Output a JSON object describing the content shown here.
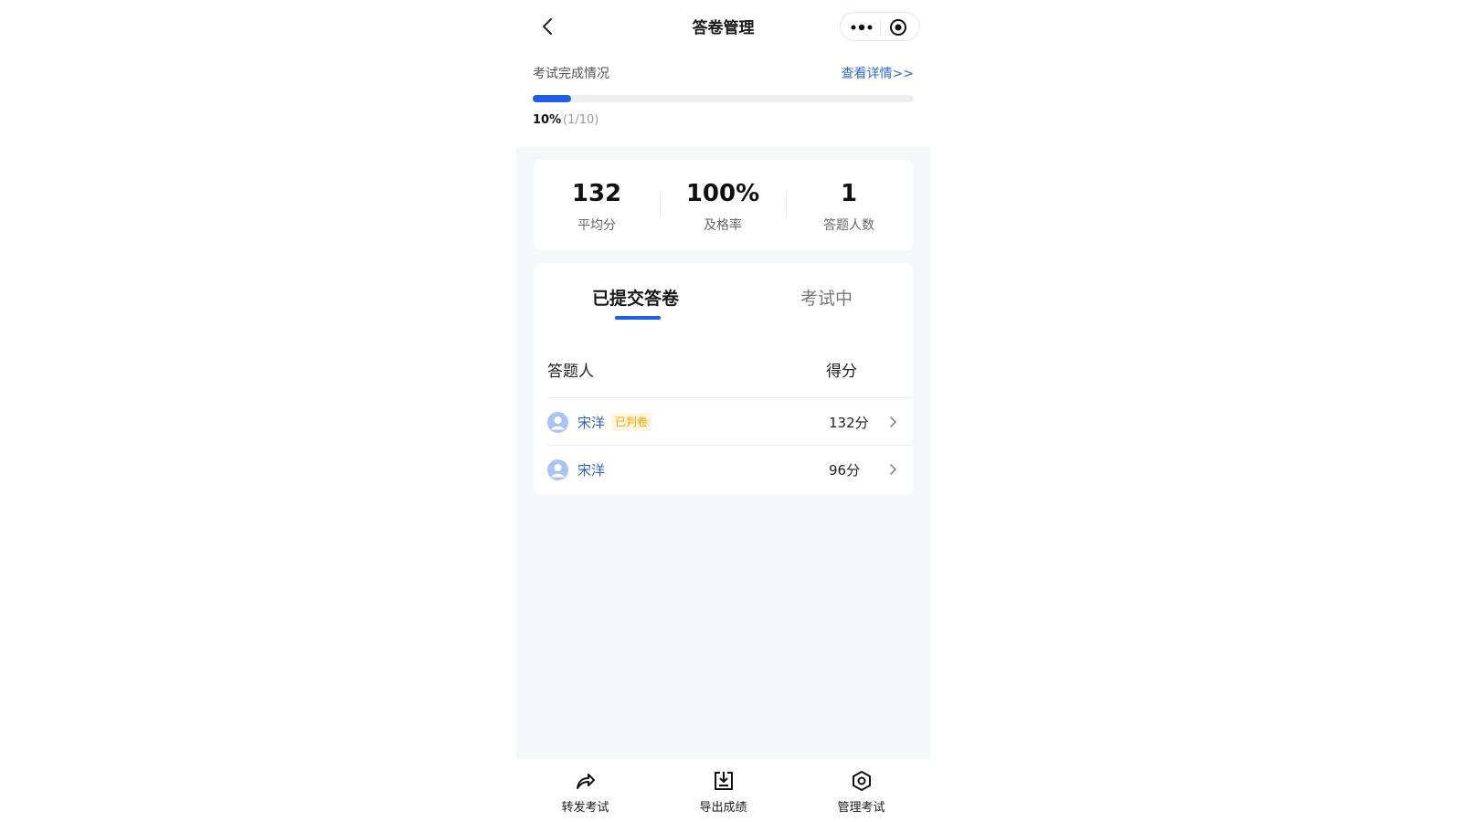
{
  "nav": {
    "title": "答卷管理"
  },
  "progress": {
    "label": "考试完成情况",
    "detail_link": "查看详情>>",
    "percent_text": "10%",
    "count_text": "(1/10)",
    "fraction": 0.1,
    "accent": "#1f5fe8"
  },
  "stats": [
    {
      "value": "132",
      "label": "平均分"
    },
    {
      "value": "100%",
      "label": "及格率"
    },
    {
      "value": "1",
      "label": "答题人数"
    }
  ],
  "tabs": [
    {
      "label": "已提交答卷",
      "active": true
    },
    {
      "label": "考试中",
      "active": false
    }
  ],
  "table": {
    "col_respondent": "答题人",
    "col_score": "得分",
    "rows": [
      {
        "name": "宋洋",
        "badge": "已判卷",
        "score": "132分"
      },
      {
        "name": "宋洋",
        "badge": "",
        "score": "96分"
      }
    ]
  },
  "tabbar": [
    {
      "label": "转发考试",
      "icon": "share-icon"
    },
    {
      "label": "导出成绩",
      "icon": "download-icon"
    },
    {
      "label": "管理考试",
      "icon": "settings-hexagon-icon"
    }
  ]
}
